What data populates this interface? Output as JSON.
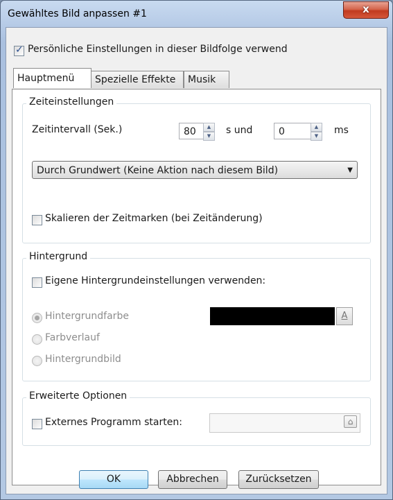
{
  "window": {
    "title": "Gewähltes Bild anpassen #1",
    "close_glyph": "x"
  },
  "personal_settings": {
    "label": "Persönliche Einstellungen in dieser Bildfolge verwend",
    "checked": true
  },
  "tabs": [
    {
      "label": "Hauptmenü",
      "active": true
    },
    {
      "label": "Spezielle Effekte",
      "active": false
    },
    {
      "label": "Musik",
      "active": false
    }
  ],
  "time_settings": {
    "title": "Zeiteinstellungen",
    "interval_label": "Zeitintervall (Sek.)",
    "seconds_value": "80",
    "and_label": "s und",
    "ms_value": "0",
    "ms_label": "ms",
    "action_select": "Durch Grundwert (Keine Aktion nach diesem Bild)",
    "scale_label": "Skalieren der Zeitmarken (bei Zeitänderung)",
    "scale_checked": false
  },
  "background": {
    "title": "Hintergrund",
    "own_settings_label": "Eigene Hintergrundeinstellungen verwenden:",
    "own_settings_checked": false,
    "options": [
      {
        "label": "Hintergrundfarbe",
        "selected": true
      },
      {
        "label": "Farbverlauf",
        "selected": false
      },
      {
        "label": "Hintergrundbild",
        "selected": false
      }
    ],
    "color_value": "#000000",
    "color_button_glyph": "A"
  },
  "advanced": {
    "title": "Erweiterte Optionen",
    "external_program_label": "Externes Programm starten:",
    "external_program_checked": false,
    "program_path": ""
  },
  "buttons": {
    "ok": "OK",
    "cancel": "Abbrechen",
    "reset": "Zurücksetzen"
  },
  "icons": [
    "close-icon",
    "checkmark-icon",
    "spin-up-icon",
    "spin-down-icon",
    "dropdown-arrow-icon",
    "color-picker-icon",
    "folder-open-icon"
  ]
}
